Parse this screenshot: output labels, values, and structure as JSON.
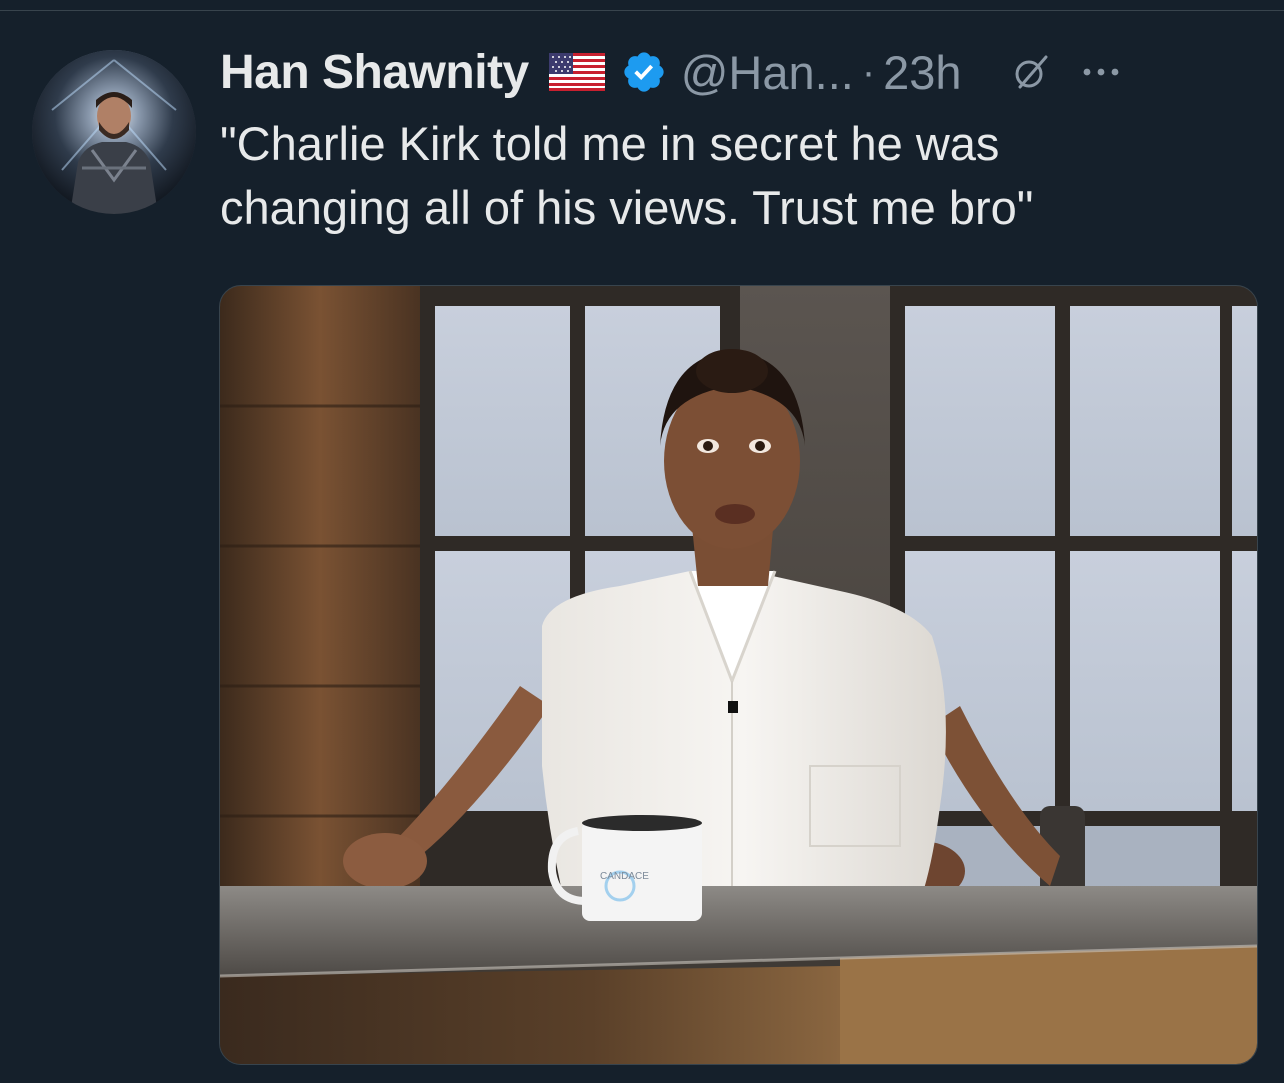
{
  "tweet": {
    "author_name": "Han Shawnity",
    "author_handle": "@Han...",
    "separator": "·",
    "timestamp": "23h",
    "text_lines": [
      "\"Charlie Kirk told me in secret he was",
      "changing all of his views. Trust me bro\""
    ],
    "author_flag": "us-flag-emoji",
    "verified_color": "#1d9bf0"
  },
  "media": {
    "mug_text": "CANDACE"
  },
  "icons": {
    "grok": "grok-icon",
    "more": "more-icon"
  },
  "colors": {
    "background": "#15202b",
    "primary_text": "#e7e9ea",
    "secondary_text": "#8b98a5",
    "accent": "#1d9bf0"
  }
}
